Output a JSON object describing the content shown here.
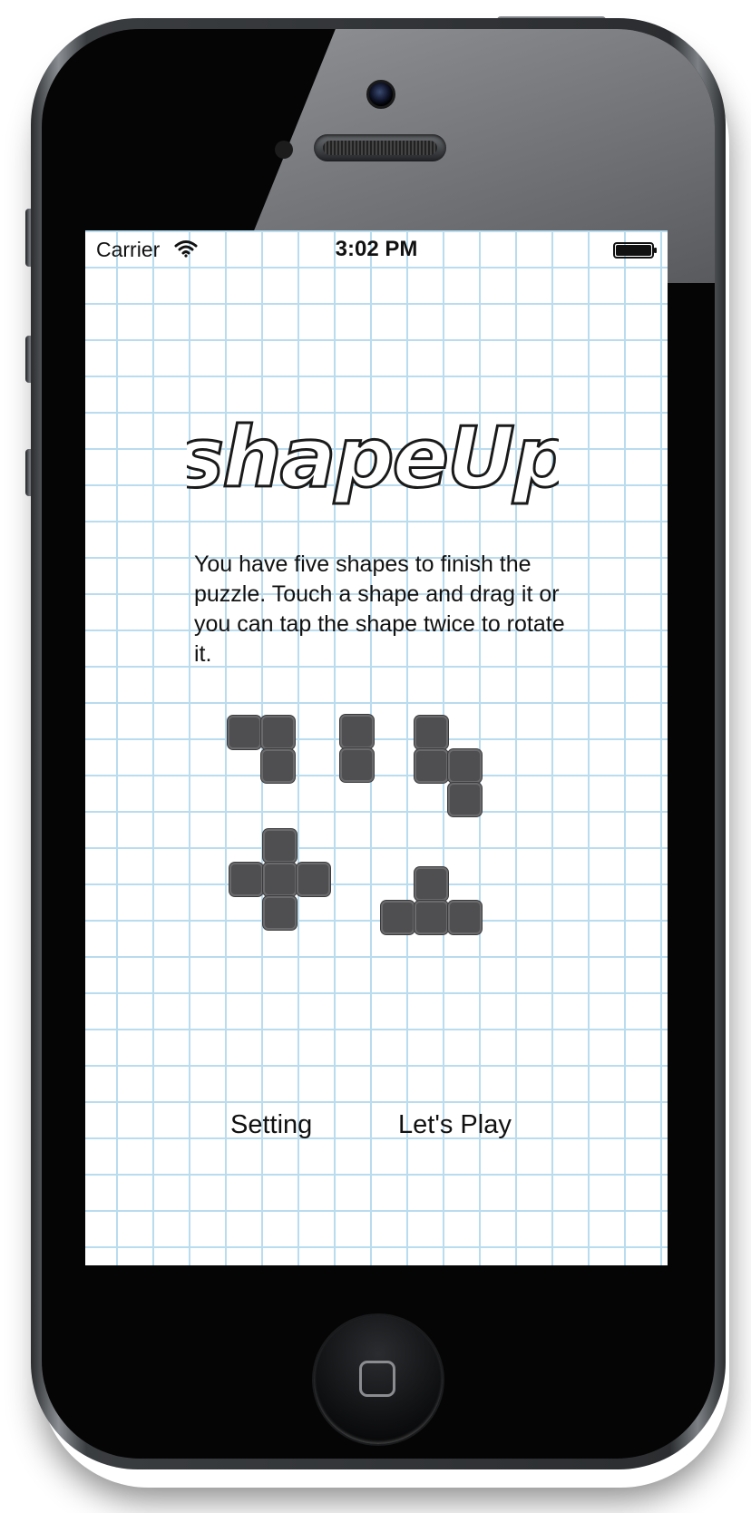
{
  "status_bar": {
    "carrier": "Carrier",
    "time": "3:02 PM",
    "wifi_icon": "wifi-icon",
    "battery_icon": "battery-full-icon"
  },
  "app": {
    "logo_text": "shapeUp",
    "instructions": "You have five shapes to finish the puzzle. Touch a shape and drag it or you can tap the shape twice to rotate it.",
    "shapes": [
      "shape-l-tromino",
      "shape-i-domino",
      "shape-s-tetromino",
      "shape-plus-pentomino",
      "shape-t-tetromino"
    ],
    "setting_label": "Setting",
    "play_label": "Let's Play"
  },
  "colors": {
    "grid_line": "#b9dcef",
    "tile": "#4f4f51",
    "text": "#111111"
  }
}
